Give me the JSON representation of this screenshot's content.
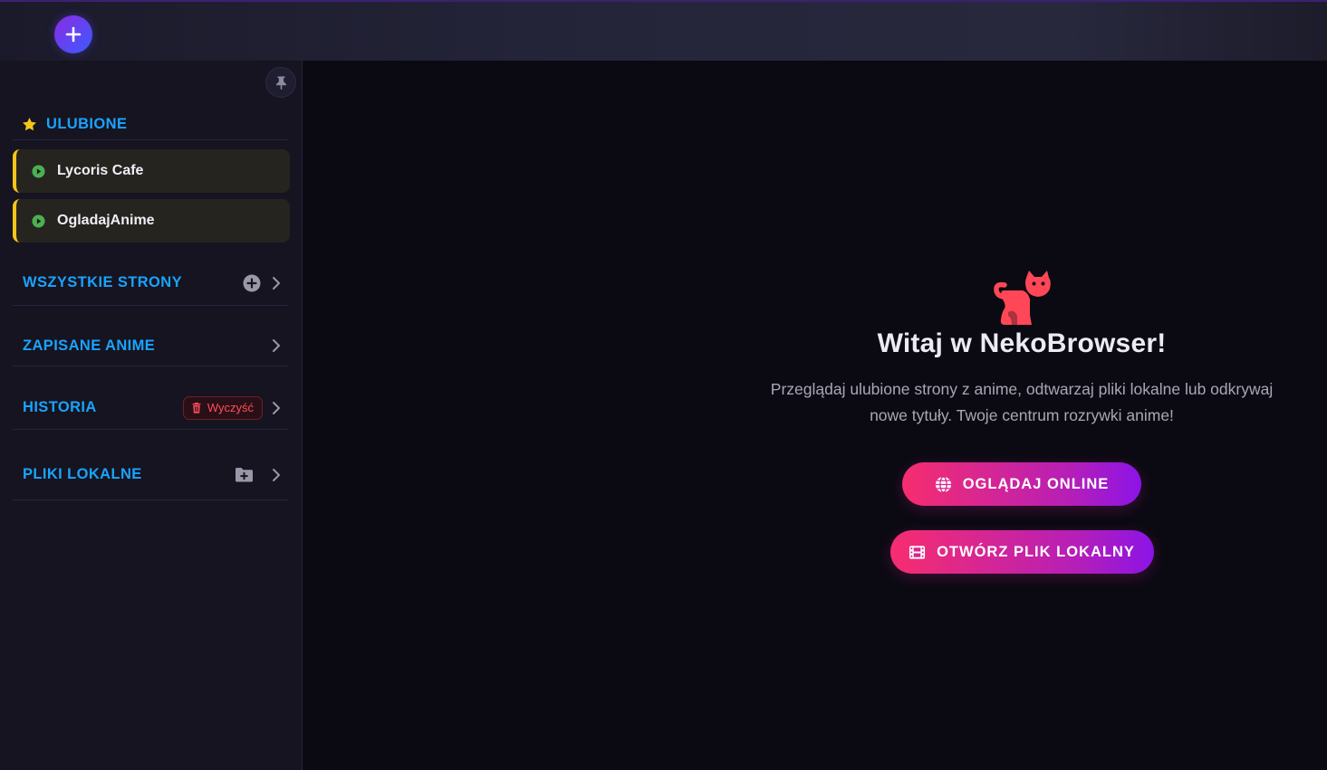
{
  "topbar": {
    "new_tab_icon": "plus-icon"
  },
  "sidebar": {
    "pin_icon": "thumbtack-icon",
    "favorites": {
      "title": "ULUBIONE",
      "icon": "star-icon",
      "items": [
        {
          "label": "Lycoris Cafe",
          "icon": "play-circle-icon"
        },
        {
          "label": "OgladajAnime",
          "icon": "play-circle-icon"
        }
      ]
    },
    "sections": {
      "all_sites": {
        "title": "WSZYSTKIE STRONY",
        "action_icon": "circle-plus-icon"
      },
      "saved_anime": {
        "title": "ZAPISANE ANIME"
      },
      "history": {
        "title": "HISTORIA",
        "clear_label": "Wyczyść",
        "clear_icon": "trash-icon"
      },
      "local_files": {
        "title": "PLIKI LOKALNE",
        "action_icon": "folder-plus-icon"
      }
    }
  },
  "main": {
    "welcome_icon": "cat-icon",
    "title": "Witaj w NekoBrowser!",
    "description": "Przeglądaj ulubione strony z anime, odtwarzaj pliki lokalne lub odkrywaj nowe tytuły. Twoje centrum rozrywki anime!",
    "buttons": {
      "watch_online": {
        "label": "OGLĄDAJ ONLINE",
        "icon": "globe-icon"
      },
      "open_local": {
        "label": "OTWÓRZ PLIK LOKALNY",
        "icon": "film-icon"
      }
    }
  },
  "colors": {
    "accent_blue": "#1aa3ff",
    "favorite_gold": "#f5c518",
    "play_green": "#4caf50",
    "danger_red": "#ff4d5e",
    "cat_red": "#ff4757",
    "gradient_start": "#f72d6f",
    "gradient_end": "#8b14e6"
  }
}
